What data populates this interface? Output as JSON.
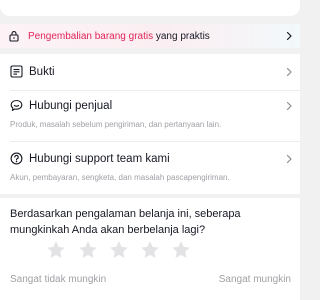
{
  "promo": {
    "accent_text": "Pengembalian barang gratis",
    "rest_text": " yang praktis",
    "icon": "lock-icon",
    "accent_color": "#e1245a"
  },
  "menu": {
    "items": [
      {
        "icon": "receipt-icon",
        "title": "Bukti",
        "subtitle": ""
      },
      {
        "icon": "chat-bubble-icon",
        "title": "Hubungi penjual",
        "subtitle": "Produk, masalah sebelum pengiriman, dan pertanyaan lain."
      },
      {
        "icon": "help-circle-icon",
        "title": "Hubungi support team kami",
        "subtitle": "Akun, pembayaran, sengketa, dan masalah pascapengiriman."
      }
    ]
  },
  "survey": {
    "question": "Berdasarkan pengalaman belanja ini, seberapa mungkinkah Anda akan berbelanja lagi?",
    "rating": 0,
    "max_rating": 5,
    "low_label": "Sangat tidak mungkin",
    "high_label": "Sangat mungkin"
  }
}
